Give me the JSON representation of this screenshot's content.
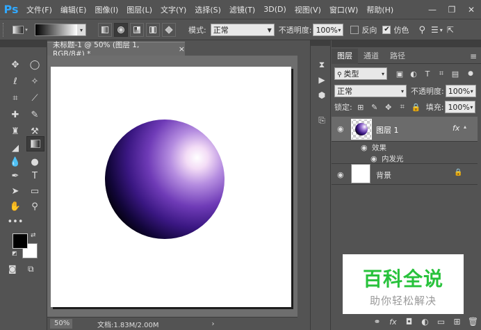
{
  "app": {
    "logo": "Ps"
  },
  "menu": [
    "文件(F)",
    "编辑(E)",
    "图像(I)",
    "图层(L)",
    "文字(Y)",
    "选择(S)",
    "滤镜(T)",
    "3D(D)",
    "视图(V)",
    "窗口(W)",
    "帮助(H)"
  ],
  "window_controls": {
    "minimize": "—",
    "restore": "❐",
    "close": "✕"
  },
  "options": {
    "mode_label": "模式:",
    "mode_value": "正常",
    "opacity_label": "不透明度:",
    "opacity_value": "100%",
    "reverse_label": "反向",
    "dither_label": "仿色",
    "reverse_checked": false,
    "dither_checked": true
  },
  "document": {
    "tab_title": "未标题-1 @ 50% (图层 1, RGB/8#) *",
    "zoom": "50%",
    "doc_info": "文档:1.83M/2.00M"
  },
  "layers_panel": {
    "tabs": [
      "图层",
      "通道",
      "路径"
    ],
    "filter_type": "类型",
    "blend_mode": "正常",
    "opacity_label": "不透明度:",
    "opacity_value": "100%",
    "lock_label": "锁定:",
    "fill_label": "填充:",
    "fill_value": "100%",
    "layers": [
      {
        "name": "图层 1",
        "fx": "fx",
        "effects_label": "效果",
        "effect": "内发光"
      },
      {
        "name": "背景"
      }
    ]
  },
  "watermark": {
    "title": "百科全说",
    "subtitle": "助你轻松解决"
  },
  "colors": {
    "accent": "#31a8ff",
    "watermark_green": "#28c23c",
    "ui_bg": "#535353"
  }
}
